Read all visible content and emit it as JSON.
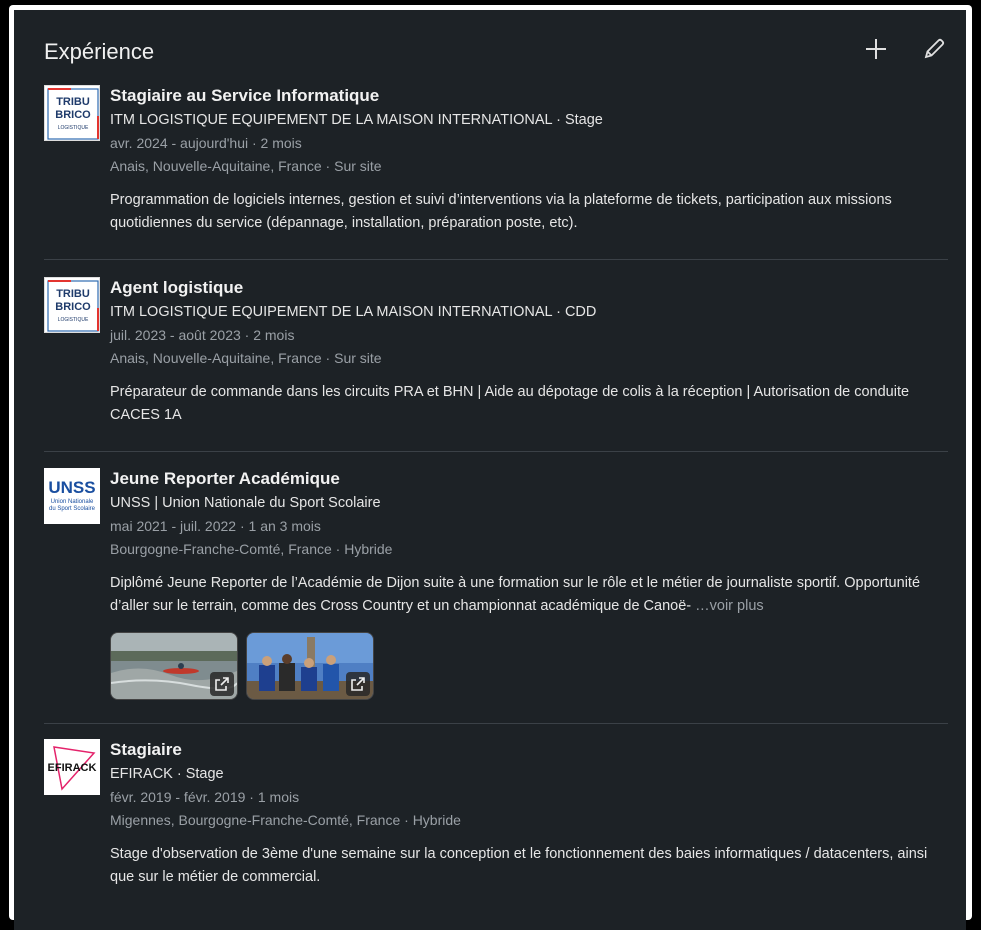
{
  "section": {
    "title": "Expérience",
    "add_icon": "plus-icon",
    "edit_icon": "pencil-icon"
  },
  "experiences": [
    {
      "logo": "TRIBU BRICO LOGISTIQUE",
      "logo_lines": [
        "TRIBU",
        "BRICO",
        "LOGISTIQUE"
      ],
      "role": "Stagiaire au Service Informatique",
      "company": "ITM LOGISTIQUE EQUIPEMENT DE LA MAISON INTERNATIONAL · Stage",
      "dates": "avr. 2024 - aujourd'hui · 2 mois",
      "location": "Anais, Nouvelle-Aquitaine, France · Sur site",
      "description": "Programmation de logiciels internes, gestion et suivi d’interventions via la plateforme de tickets, participation aux missions quotidiennes du service (dépannage, installation, préparation poste, etc)."
    },
    {
      "logo": "TRIBU BRICO LOGISTIQUE",
      "logo_lines": [
        "TRIBU",
        "BRICO",
        "LOGISTIQUE"
      ],
      "role": "Agent logistique",
      "company": "ITM LOGISTIQUE EQUIPEMENT DE LA MAISON INTERNATIONAL · CDD",
      "dates": "juil. 2023 - août 2023 · 2 mois",
      "location": "Anais, Nouvelle-Aquitaine, France · Sur site",
      "description": "Préparateur de commande dans les circuits PRA et BHN | Aide au dépotage de colis à la réception | Autorisation de conduite CACES 1A"
    },
    {
      "logo": "UNSS Union Nationale du Sport Scolaire",
      "logo_lines": [
        "UNSS",
        "Union Nationale",
        "du Sport Scolaire"
      ],
      "role": "Jeune Reporter Académique",
      "company": "UNSS | Union Nationale du Sport Scolaire",
      "dates": "mai 2021 - juil. 2022 · 1 an 3 mois",
      "location": "Bourgogne-Franche-Comté, France · Hybride",
      "description": "Diplômé Jeune Reporter de l’Académie de Dijon suite à une formation sur le rôle et le métier de journaliste sportif. Opportunité d’aller sur le terrain, comme des Cross Country et un championnat académique de Canoë-",
      "see_more": "…voir plus",
      "media": [
        "external-link-icon",
        "external-link-icon"
      ]
    },
    {
      "logo": "EFIRACK",
      "logo_lines": [
        "EFIRACK"
      ],
      "role": "Stagiaire",
      "company": "EFIRACK · Stage",
      "dates": "févr. 2019 - févr. 2019 · 1 mois",
      "location": "Migennes, Bourgogne-Franche-Comté, France · Hybride",
      "description": "Stage d'observation de 3ème d'une semaine sur la conception et le fonctionnement des baies informatiques / datacenters, ainsi que sur le métier de commercial."
    }
  ]
}
